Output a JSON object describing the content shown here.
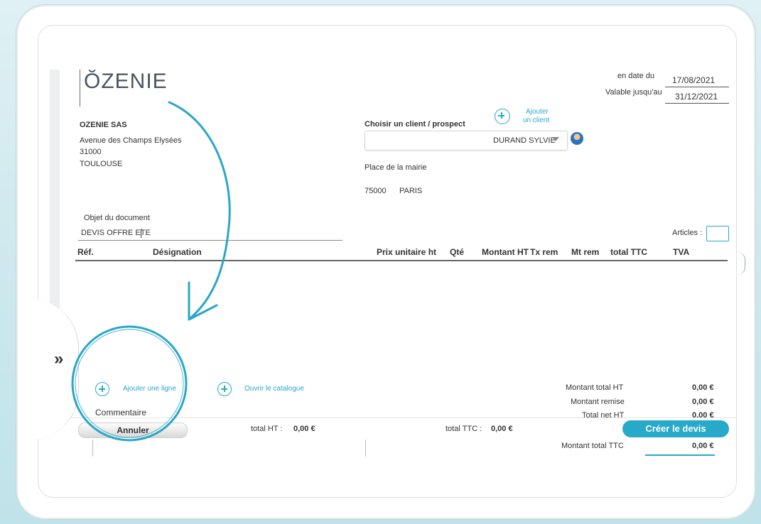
{
  "header": {
    "logo": "ŎZENIE",
    "date_label": "en date du",
    "date_value": "17/08/2021",
    "valid_label": "Valable jusqu'au",
    "valid_value": "31/12/2021"
  },
  "company": {
    "name": "OZENIE SAS",
    "address": "Avenue des Champs Elysées",
    "zip": "31000",
    "city": "TOULOUSE"
  },
  "client": {
    "choose_label": "Choisir un client / prospect",
    "add_line1": "Ajouter",
    "add_line2": "un client",
    "selected": "DURAND SYLVIE",
    "address": "Place de la mairie",
    "zip": "75000",
    "city": "PARIS"
  },
  "document": {
    "object_label": "Objet du document",
    "object_value": "DEVIS OFFRE ETE",
    "articles_label": "Articles :"
  },
  "table": {
    "columns": [
      "Réf.",
      "Désignation",
      "Prix unitaire ht",
      "Qté",
      "Montant HT",
      "Tx rem",
      "Mt rem",
      "total TTC",
      "TVA"
    ]
  },
  "actions": {
    "add_line": "Ajouter une ligne",
    "open_catalog": "Ouvrir le catalogue",
    "comment": "Commentaire"
  },
  "totals": {
    "total_ht_label": "Montant total HT",
    "total_ht_value": "0,00 €",
    "remise_label": "Montant remise",
    "remise_value": "0,00 €",
    "net_ht_label": "Total net HT",
    "net_ht_value": "0,00 €",
    "total_ttc_label": "Montant total TTC",
    "total_ttc_value": "0,00 €"
  },
  "footer": {
    "cancel": "Annuler",
    "total_ht_label": "total HT :",
    "total_ht_value": "0,00 €",
    "total_ttc_label": "total TTC :",
    "total_ttc_value": "0,00 €",
    "create": "Créer le devis"
  },
  "colors": {
    "accent": "#27a9c9"
  },
  "icons": {
    "expand": "double-chevron-right-icon",
    "add": "plus-circle-icon",
    "avatar": "user-avatar-icon"
  }
}
